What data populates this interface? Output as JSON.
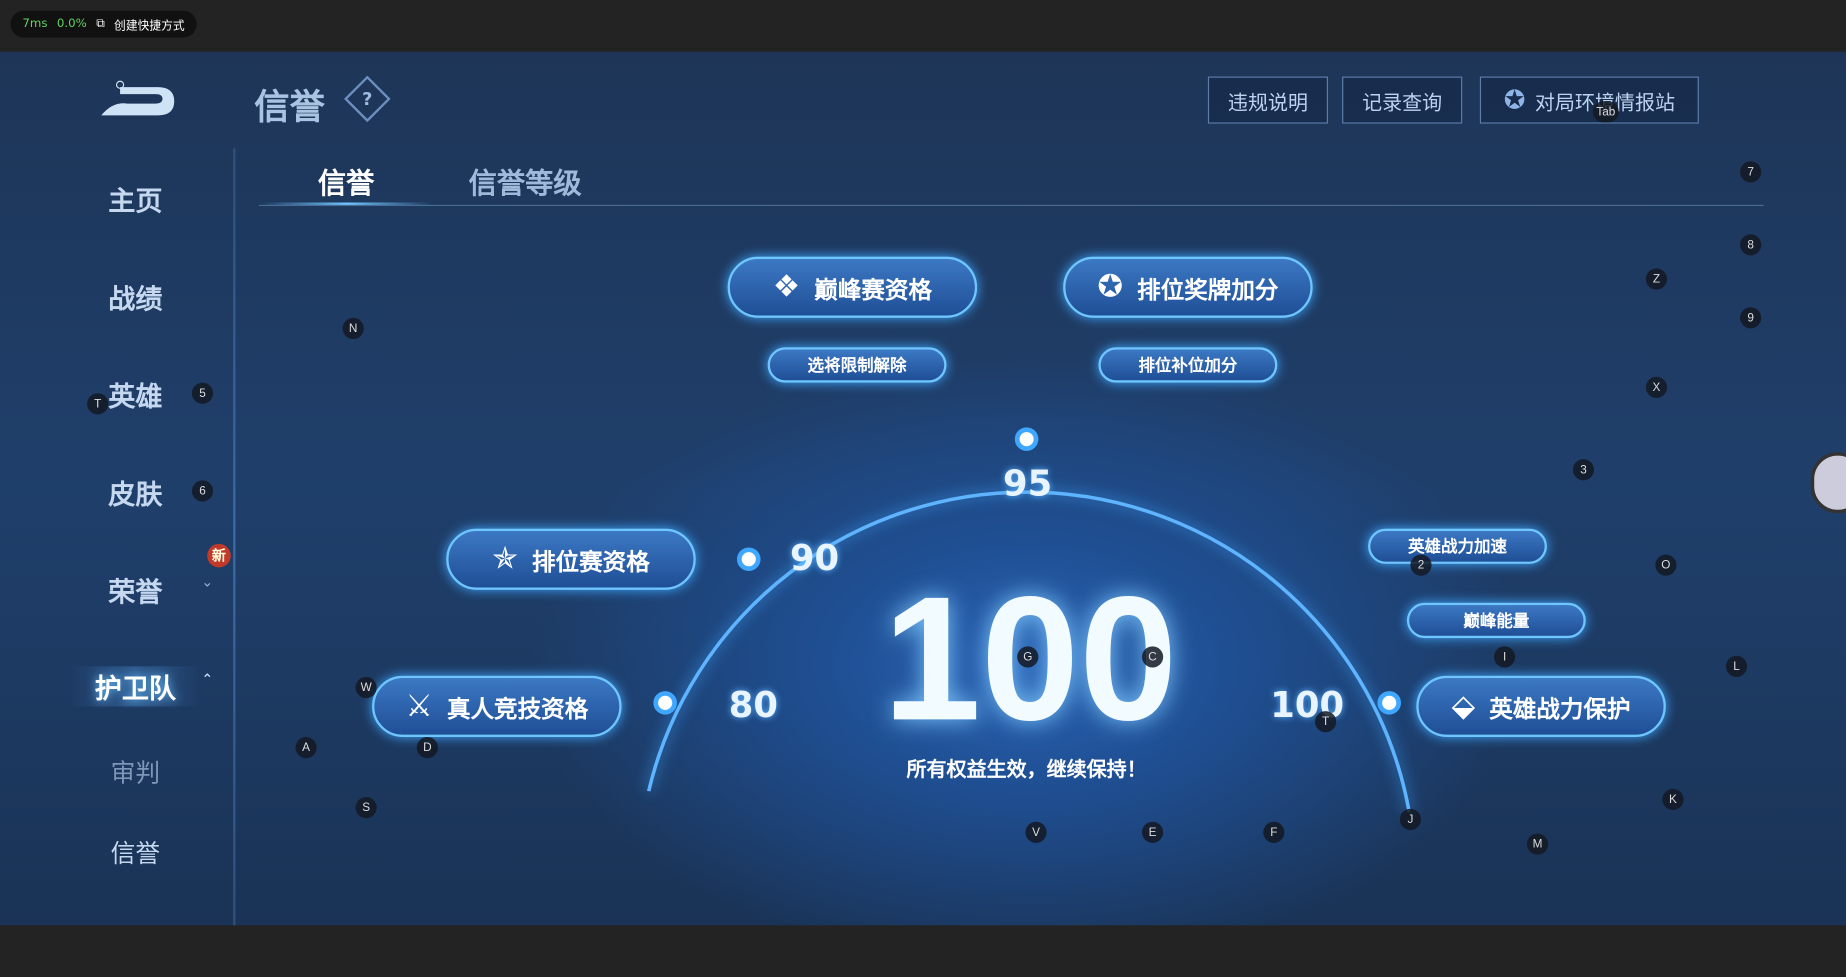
{
  "overlay": {
    "latency": "7ms",
    "cpu": "0.0%",
    "shortcut_label": "创建快捷方式"
  },
  "header": {
    "title": "信誉",
    "buttons": [
      "违规说明",
      "记录查询",
      "对局环境情报站"
    ]
  },
  "sidebar": {
    "items": [
      "主页",
      "战绩",
      "英雄",
      "皮肤",
      "荣誉",
      "护卫队",
      "审判",
      "信誉"
    ],
    "active": "护卫队",
    "new_badge": "新"
  },
  "tabs": [
    {
      "label": "信誉",
      "active": true
    },
    {
      "label": "信誉等级",
      "active": false
    }
  ],
  "benefits": {
    "peak": "巅峰赛资格",
    "peak_sub": "选将限制解除",
    "rank_medal": "排位奖牌加分",
    "rank_medal_sub": "排位补位加分",
    "ranked": "排位赛资格",
    "real_person": "真人竞技资格",
    "hero_power": "英雄战力保护",
    "hero_speed": "英雄战力加速",
    "peak_energy": "巅峰能量"
  },
  "gauge": {
    "marks": [
      "80",
      "90",
      "95",
      "100"
    ],
    "score": "100",
    "status": "所有权益生效，继续保持！",
    "value": 100
  },
  "key_hints": [
    "Tab",
    "7",
    "8",
    "Z",
    "9",
    "N",
    "X",
    "5",
    "T",
    "6",
    "3",
    "2",
    "O",
    "I",
    "G",
    "C",
    "L",
    "W",
    "T",
    "A",
    "D",
    "S",
    "V",
    "E",
    "F",
    "J",
    "K",
    "M"
  ],
  "colors": {
    "accent": "#6fc6ff",
    "background": "#1f3f6b"
  }
}
